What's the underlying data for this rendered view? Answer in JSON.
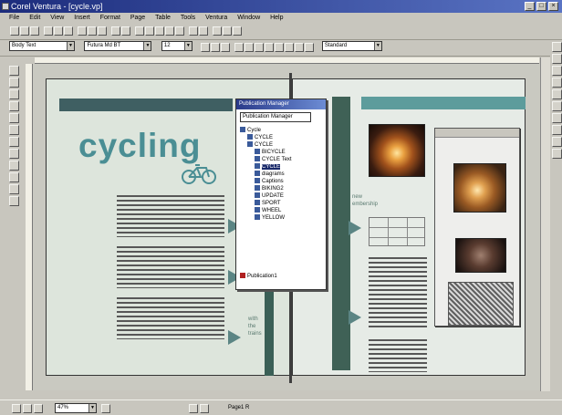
{
  "app": {
    "title": "Corel Ventura - [cycle.vp]"
  },
  "menu": [
    "File",
    "Edit",
    "View",
    "Insert",
    "Format",
    "Page",
    "Table",
    "Tools",
    "Ventura",
    "Window",
    "Help"
  ],
  "toolbar": {
    "style": "Body Text",
    "font": "Futura Md BT",
    "size": "12",
    "view_mode": "Standard"
  },
  "document": {
    "headline": "cycling",
    "captions": [
      "new embership",
      "gear",
      "with the trains"
    ]
  },
  "pub_manager": {
    "title": "Publication Manager",
    "dropdown": "Publication Manager",
    "items": [
      "Cycle",
      "CYCLE",
      "CYCLE",
      "BICYCLE",
      "CYCLE Text",
      "CYCLE",
      "diagrams",
      "Captions",
      "BIKING2",
      "UPDATE",
      "SPORT",
      "WHEEL",
      "YELLOW"
    ],
    "footer": "Publication1"
  },
  "statusbar": {
    "zoom": "47%",
    "page": "Page1 R"
  }
}
